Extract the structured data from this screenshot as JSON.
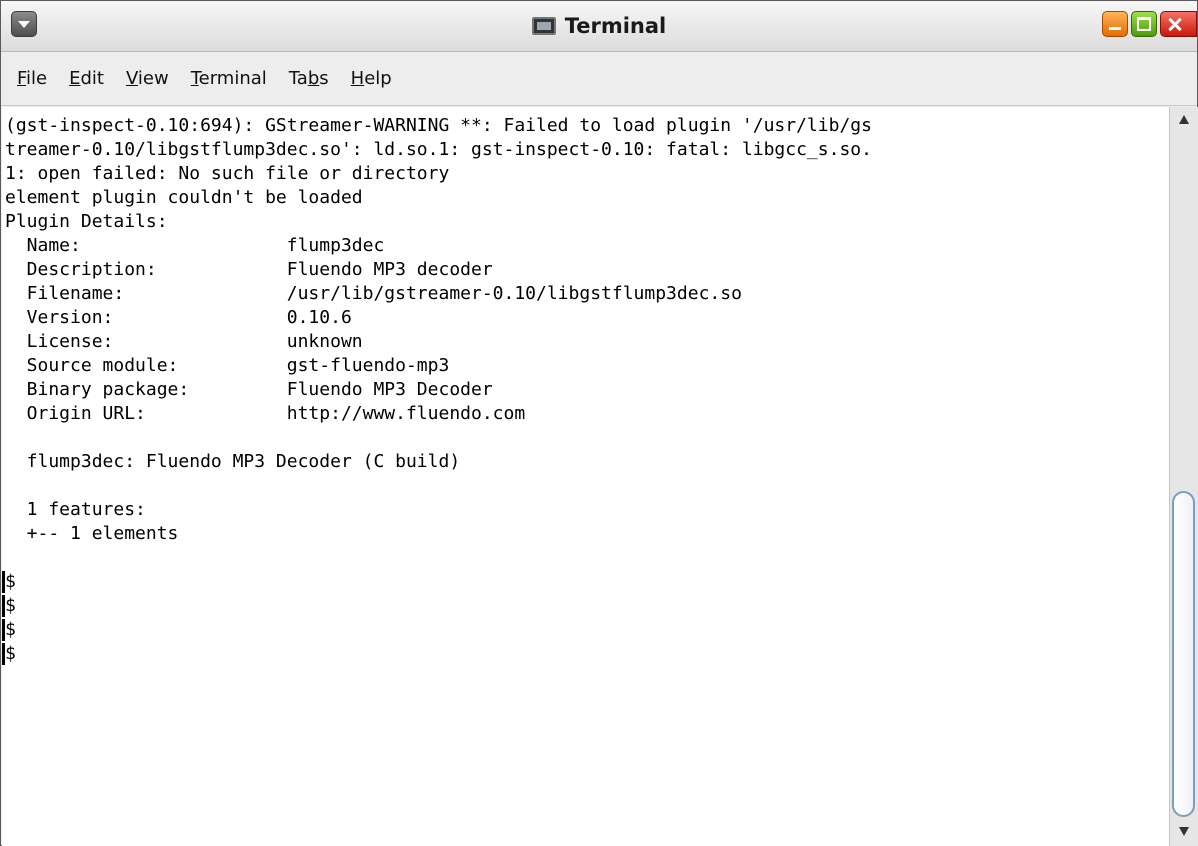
{
  "window": {
    "title": "Terminal"
  },
  "menu": [
    {
      "pre": "",
      "key": "F",
      "post": "ile"
    },
    {
      "pre": "",
      "key": "E",
      "post": "dit"
    },
    {
      "pre": "",
      "key": "V",
      "post": "iew"
    },
    {
      "pre": "",
      "key": "T",
      "post": "erminal"
    },
    {
      "pre": "Ta",
      "key": "b",
      "post": "s"
    },
    {
      "pre": "",
      "key": "H",
      "post": "elp"
    }
  ],
  "terminal": {
    "lines": [
      "(gst-inspect-0.10:694): GStreamer-WARNING **: Failed to load plugin '/usr/lib/gs",
      "treamer-0.10/libgstflump3dec.so': ld.so.1: gst-inspect-0.10: fatal: libgcc_s.so.",
      "1: open failed: No such file or directory",
      "element plugin couldn't be loaded",
      "Plugin Details:",
      "  Name:                   flump3dec",
      "  Description:            Fluendo MP3 decoder",
      "  Filename:               /usr/lib/gstreamer-0.10/libgstflump3dec.so",
      "  Version:                0.10.6",
      "  License:                unknown",
      "  Source module:          gst-fluendo-mp3",
      "  Binary package:         Fluendo MP3 Decoder",
      "  Origin URL:             http://www.fluendo.com",
      "",
      "  flump3dec: Fluendo MP3 Decoder (C build)",
      "",
      "  1 features:",
      "  +-- 1 elements",
      "",
      "$",
      "$",
      "$",
      "$"
    ]
  },
  "icons": {
    "window_menu": "window-menu-icon",
    "app": "terminal-icon",
    "minimize": "minimize-icon",
    "maximize": "maximize-icon",
    "close": "close-icon"
  }
}
